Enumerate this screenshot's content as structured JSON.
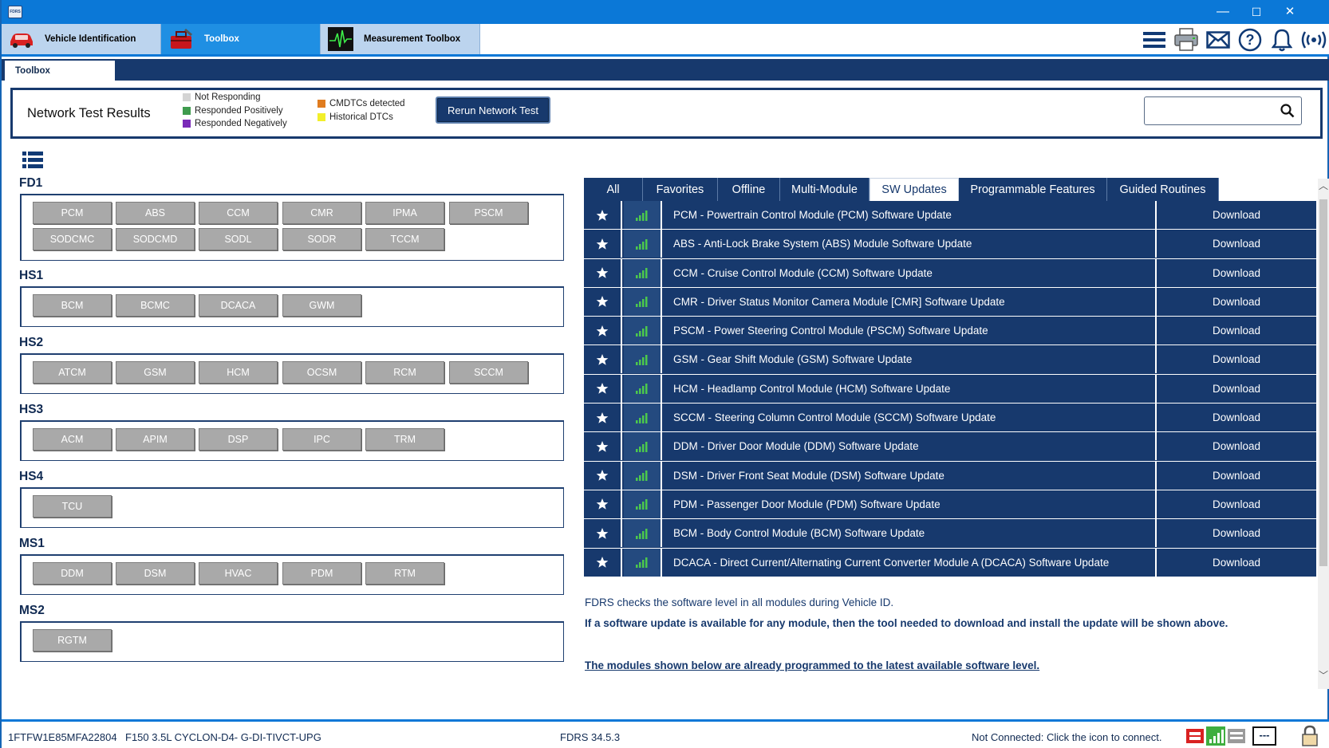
{
  "window": {
    "logo_text": "FDRS",
    "minimize": "—",
    "maximize": "☐",
    "close": "✕"
  },
  "main_tabs": [
    {
      "label": "Vehicle Identification",
      "icon": "car-icon"
    },
    {
      "label": "Toolbox",
      "icon": "toolbox-icon"
    },
    {
      "label": "Measurement Toolbox",
      "icon": "oscilloscope-icon"
    }
  ],
  "toolbar_icons": [
    "menu-icon",
    "printer-icon",
    "mail-icon",
    "help-icon",
    "bell-icon",
    "wireless-icon"
  ],
  "sub_tab": {
    "label": "Toolbox"
  },
  "network": {
    "title": "Network Test Results",
    "legend": [
      {
        "label": "Not Responding",
        "color": "#d4d4d4"
      },
      {
        "label": "Responded Positively",
        "color": "#3f9b4e"
      },
      {
        "label": "Responded Negatively",
        "color": "#7a2bb8"
      },
      {
        "label": "CMDTCs detected",
        "color": "#e07c1f"
      },
      {
        "label": "Historical DTCs",
        "color": "#f2ef2a"
      }
    ],
    "rerun_label": "Rerun Network Test",
    "search_value": ""
  },
  "groups": [
    {
      "name": "FD1",
      "modules": [
        "PCM",
        "ABS",
        "CCM",
        "CMR",
        "IPMA",
        "PSCM",
        "SODCMC",
        "SODCMD",
        "SODL",
        "SODR",
        "TCCM"
      ]
    },
    {
      "name": "HS1",
      "modules": [
        "BCM",
        "BCMC",
        "DCACA",
        "GWM"
      ]
    },
    {
      "name": "HS2",
      "modules": [
        "ATCM",
        "GSM",
        "HCM",
        "OCSM",
        "RCM",
        "SCCM"
      ]
    },
    {
      "name": "HS3",
      "modules": [
        "ACM",
        "APIM",
        "DSP",
        "IPC",
        "TRM"
      ]
    },
    {
      "name": "HS4",
      "modules": [
        "TCU"
      ]
    },
    {
      "name": "MS1",
      "modules": [
        "DDM",
        "DSM",
        "HVAC",
        "PDM",
        "RTM"
      ]
    },
    {
      "name": "MS2",
      "modules": [
        "RGTM"
      ]
    }
  ],
  "right_tabs": [
    "All",
    "Favorites",
    "Offline",
    "Multi-Module",
    "SW Updates",
    "Programmable Features",
    "Guided Routines"
  ],
  "active_right_tab": "SW Updates",
  "updates": [
    {
      "desc": "PCM - Powertrain Control Module (PCM) Software Update",
      "action": "Download"
    },
    {
      "desc": "ABS - Anti-Lock Brake System (ABS) Module Software Update",
      "action": "Download"
    },
    {
      "desc": "CCM - Cruise Control Module (CCM) Software Update",
      "action": "Download"
    },
    {
      "desc": "CMR - Driver Status Monitor Camera Module [CMR] Software Update",
      "action": "Download"
    },
    {
      "desc": "PSCM - Power Steering Control Module (PSCM) Software Update",
      "action": "Download"
    },
    {
      "desc": "GSM - Gear Shift Module (GSM) Software Update",
      "action": "Download"
    },
    {
      "desc": "HCM - Headlamp Control Module (HCM) Software Update",
      "action": "Download"
    },
    {
      "desc": "SCCM - Steering Column Control Module (SCCM) Software Update",
      "action": "Download"
    },
    {
      "desc": "DDM - Driver Door Module (DDM) Software Update",
      "action": "Download"
    },
    {
      "desc": "DSM - Driver Front Seat Module (DSM) Software Update",
      "action": "Download"
    },
    {
      "desc": "PDM - Passenger Door Module (PDM) Software Update",
      "action": "Download"
    },
    {
      "desc": "BCM - Body Control Module (BCM) Software Update",
      "action": "Download"
    },
    {
      "desc": "DCACA - Direct Current/Alternating Current Converter Module A (DCACA) Software Update",
      "action": "Download"
    }
  ],
  "info": {
    "line1": "FDRS checks the software level in all modules during Vehicle ID.",
    "line2": "If a software update is available for any module, then the tool needed to download and install the update will be shown above.",
    "line3": "The modules shown below are already programmed to the latest available software level."
  },
  "status": {
    "vin": "1FTFW1E85MFA22804",
    "vehicle": "F150 3.5L CYCLON-D4- G-DI-TIVCT-UPG",
    "version": "FDRS 34.5.3",
    "connection": "Not Connected: Click the icon to connect.",
    "dash": "---"
  },
  "colors": {
    "navy": "#17396d",
    "accent_blue": "#0b78d7",
    "module_grey": "#a9a9a9",
    "signal_green": "#4cc94c"
  }
}
